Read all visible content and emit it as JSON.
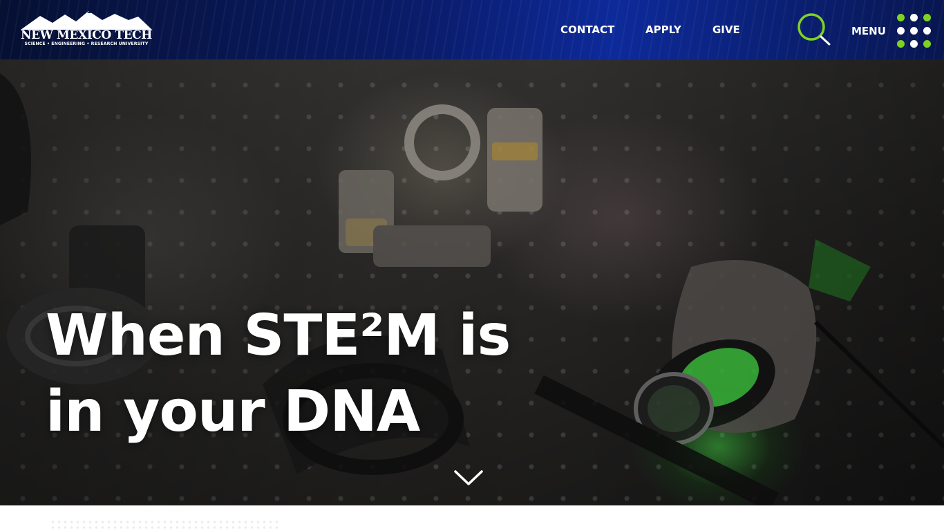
{
  "header": {
    "logo": {
      "name": "NEW MEXICO TECH",
      "tagline": "SCIENCE • ENGINEERING • RESEARCH UNIVERSITY"
    },
    "nav": [
      {
        "label": "CONTACT"
      },
      {
        "label": "APPLY"
      },
      {
        "label": "GIVE"
      }
    ],
    "search_icon": "search-icon",
    "menu": {
      "label": "MENU",
      "icon": "grid-dots-icon"
    }
  },
  "hero": {
    "heading_line1": "When STE²M is",
    "heading_line2": "in your DNA",
    "scroll_icon": "chevron-down-icon"
  },
  "colors": {
    "header_blue": "#0d2a9a",
    "accent_green": "#7ed321",
    "text_white": "#ffffff"
  }
}
